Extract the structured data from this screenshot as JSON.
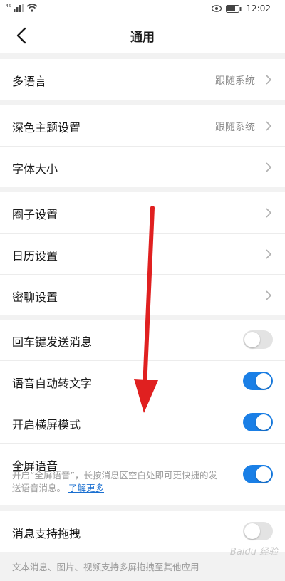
{
  "status": {
    "signal_label": "⁴⁶",
    "time": "12:02"
  },
  "header": {
    "title": "通用"
  },
  "groups": {
    "language": {
      "label": "多语言",
      "value": "跟随系统"
    },
    "theme": {
      "label": "深色主题设置",
      "value": "跟随系统"
    },
    "font": {
      "label": "字体大小"
    },
    "circle": {
      "label": "圈子设置"
    },
    "calendar": {
      "label": "日历设置"
    },
    "secret": {
      "label": "密聊设置"
    },
    "enter_send": {
      "label": "回车键发送消息",
      "enabled": false
    },
    "voice_to_text": {
      "label": "语音自动转文字",
      "enabled": true
    },
    "landscape": {
      "label": "开启横屏模式",
      "enabled": true
    },
    "fullscreen_voice": {
      "label": "全屏语音",
      "desc": "开启“全屏语音”，长按消息区空白处即可更快捷的发送语音消息。",
      "link": "了解更多",
      "enabled": true
    },
    "drag": {
      "label": "消息支持拖拽",
      "enabled": false
    }
  },
  "footnote": "文本消息、图片、视频支持多屏拖拽至其他应用",
  "watermark": "Baidu 经验",
  "colors": {
    "accent": "#1a7fe6",
    "arrow": "#e02020"
  }
}
